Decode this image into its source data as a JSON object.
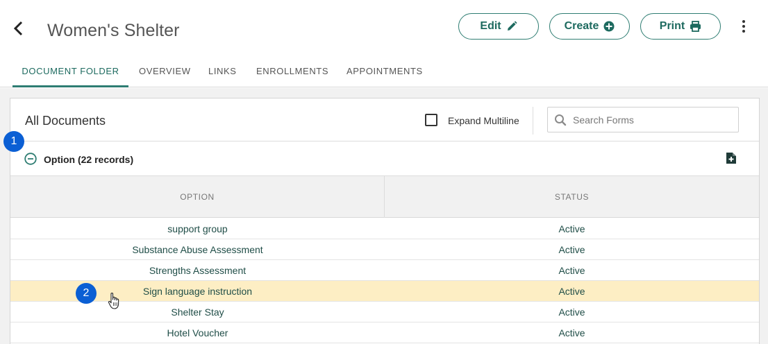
{
  "header": {
    "title": "Women's Shelter",
    "buttons": {
      "edit": "Edit",
      "create": "Create",
      "print": "Print"
    },
    "accent_color": "#2e7d72"
  },
  "tabs": [
    {
      "label": "DOCUMENT FOLDER",
      "active": true
    },
    {
      "label": "OVERVIEW",
      "active": false
    },
    {
      "label": "LINKS",
      "active": false
    },
    {
      "label": "ENROLLMENTS",
      "active": false
    },
    {
      "label": "APPOINTMENTS",
      "active": false
    }
  ],
  "panel": {
    "title": "All Documents",
    "expand_multiline_label": "Expand Multiline",
    "expand_multiline_checked": false,
    "search_placeholder": "Search Forms"
  },
  "group": {
    "label": "Option (22 records)"
  },
  "table": {
    "columns": [
      "OPTION",
      "STATUS"
    ],
    "rows": [
      {
        "option": "support group",
        "status": "Active"
      },
      {
        "option": "Substance Abuse Assessment",
        "status": "Active"
      },
      {
        "option": "Strengths Assessment",
        "status": "Active"
      },
      {
        "option": "Sign language instruction",
        "status": "Active",
        "highlighted": true
      },
      {
        "option": "Shelter Stay",
        "status": "Active"
      },
      {
        "option": "Hotel Voucher",
        "status": "Active"
      }
    ]
  },
  "markers": [
    "1",
    "2"
  ],
  "icons": {
    "back": "chevron-left-icon",
    "edit": "pencil-icon",
    "create": "plus-circle-icon",
    "print": "printer-icon",
    "more": "kebab-icon",
    "search": "search-icon",
    "collapse": "minus-circle-icon",
    "add_document": "file-plus-icon",
    "cursor": "hand-pointer-icon"
  }
}
